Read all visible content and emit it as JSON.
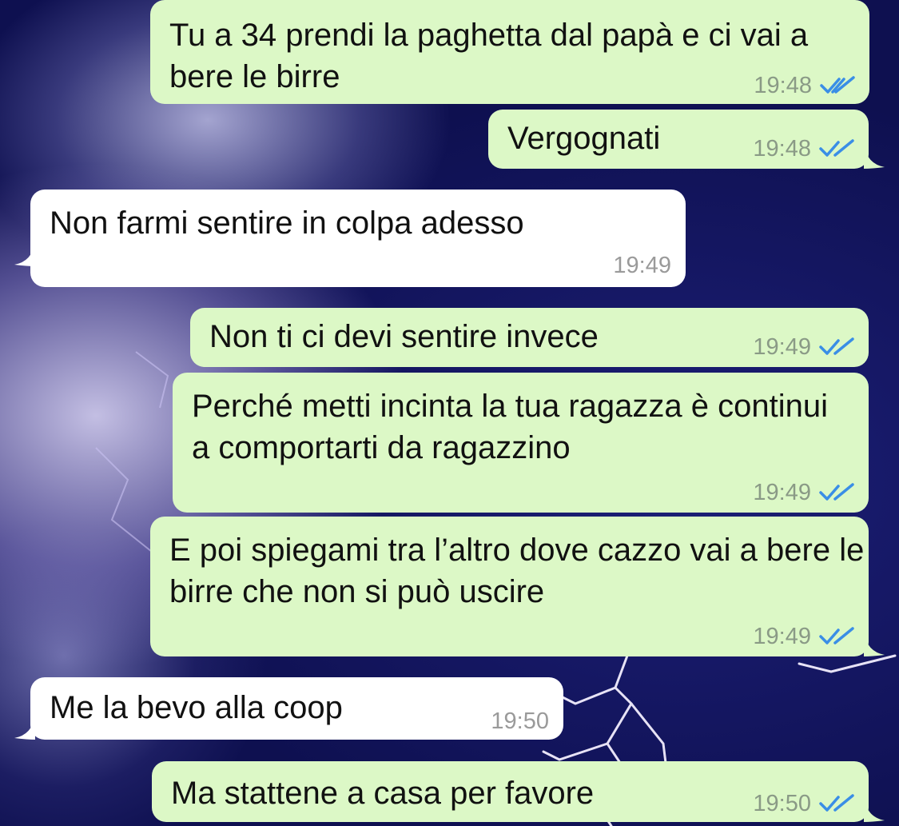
{
  "messages": [
    {
      "dir": "out",
      "text": "Tu a 34 prendi la paghetta dal papà e ci vai a bere le birre",
      "time": "19:48",
      "read": true
    },
    {
      "dir": "out",
      "text": "Vergognati",
      "time": "19:48",
      "read": true
    },
    {
      "dir": "in",
      "text": "Non farmi sentire in colpa adesso",
      "time": "19:49"
    },
    {
      "dir": "out",
      "text": "Non ti ci devi sentire invece",
      "time": "19:49",
      "read": true
    },
    {
      "dir": "out",
      "text": "Perché metti incinta la tua ragazza è continui a comportarti da ragazzino",
      "time": "19:49",
      "read": true
    },
    {
      "dir": "out",
      "text": "E poi spiegami tra l’altro dove cazzo vai a bere le birre che non si può uscire",
      "time": "19:49",
      "read": true
    },
    {
      "dir": "in",
      "text": "Me la bevo alla coop",
      "time": "19:50"
    },
    {
      "dir": "out",
      "text": "Ma stattene a casa per favore",
      "time": "19:50",
      "read": true
    }
  ],
  "colors": {
    "outgoing_bubble": "#dcf8c6",
    "incoming_bubble": "#ffffff",
    "read_ticks": "#3a8ee6"
  },
  "icons": {
    "read_receipt": "double-check-icon"
  }
}
